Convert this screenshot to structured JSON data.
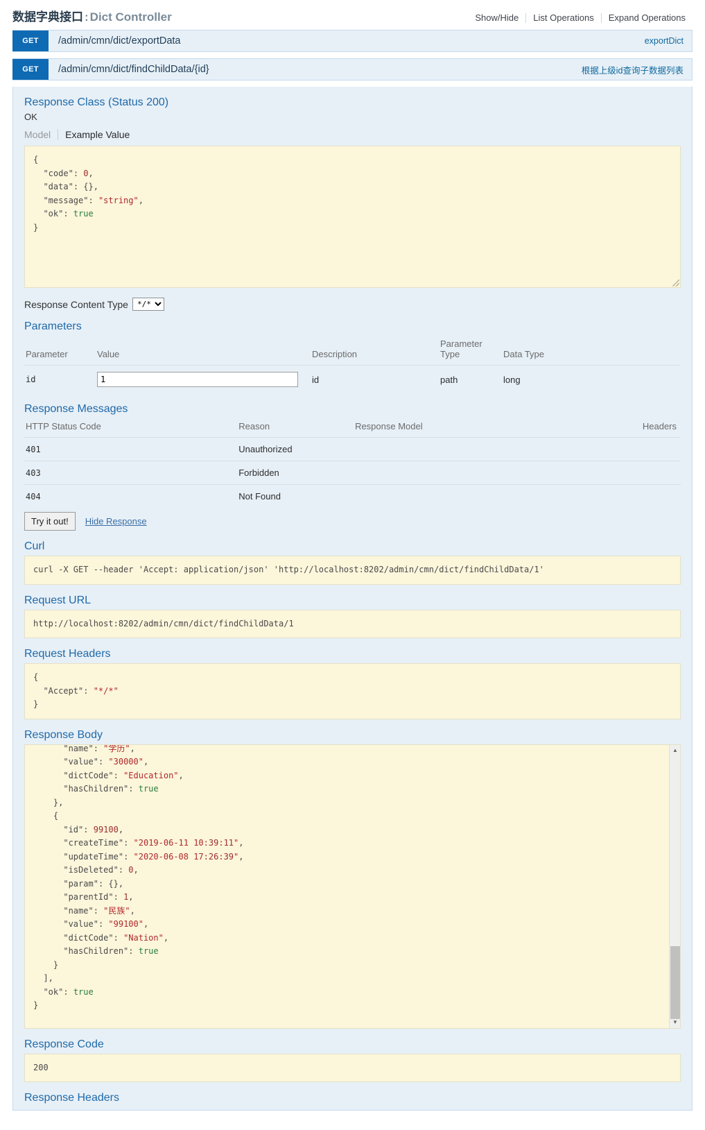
{
  "resource": {
    "title_cn": "数据字典接口",
    "title_sep": " : ",
    "title_en": "Dict Controller",
    "options": {
      "show_hide": "Show/Hide",
      "list_operations": "List Operations",
      "expand_operations": "Expand Operations"
    }
  },
  "endpoints": [
    {
      "method": "GET",
      "path": "/admin/cmn/dict/exportData",
      "summary": "exportDict"
    },
    {
      "method": "GET",
      "path": "/admin/cmn/dict/findChildData/{id}",
      "summary": "根据上级id查询子数据列表"
    }
  ],
  "operation": {
    "response_class_heading": "Response Class (Status 200)",
    "response_class_status": "OK",
    "model_tab": "Model",
    "example_value_tab": "Example Value",
    "example_value": "{\n  \"code\": 0,\n  \"data\": {},\n  \"message\": \"string\",\n  \"ok\": true\n}",
    "content_type_label": "Response Content Type",
    "content_type_selected": "*/*",
    "content_type_options": [
      "*/*"
    ],
    "parameters_heading": "Parameters",
    "parameters_columns": [
      "Parameter",
      "Value",
      "Description",
      "Parameter Type",
      "Data Type"
    ],
    "parameters_rows": [
      {
        "parameter": "id",
        "value": "1",
        "description": "id",
        "parameter_type": "path",
        "data_type": "long"
      }
    ],
    "response_messages_heading": "Response Messages",
    "response_messages_columns": [
      "HTTP Status Code",
      "Reason",
      "Response Model",
      "Headers"
    ],
    "response_messages_rows": [
      {
        "code": "401",
        "reason": "Unauthorized",
        "model": "",
        "headers": ""
      },
      {
        "code": "403",
        "reason": "Forbidden",
        "model": "",
        "headers": ""
      },
      {
        "code": "404",
        "reason": "Not Found",
        "model": "",
        "headers": ""
      }
    ],
    "try_it_out_label": "Try it out!",
    "hide_response_label": "Hide Response",
    "curl_heading": "Curl",
    "curl_command": "curl -X GET --header 'Accept: application/json' 'http://localhost:8202/admin/cmn/dict/findChildData/1'",
    "request_url_heading": "Request URL",
    "request_url": "http://localhost:8202/admin/cmn/dict/findChildData/1",
    "request_headers_heading": "Request Headers",
    "request_headers": "{\n  \"Accept\": \"*/*\"\n}",
    "response_body_heading": "Response Body",
    "response_body": "      \"name\": \"学历\",\n      \"value\": \"30000\",\n      \"dictCode\": \"Education\",\n      \"hasChildren\": true\n    },\n    {\n      \"id\": 99100,\n      \"createTime\": \"2019-06-11 10:39:11\",\n      \"updateTime\": \"2020-06-08 17:26:39\",\n      \"isDeleted\": 0,\n      \"param\": {},\n      \"parentId\": 1,\n      \"name\": \"民族\",\n      \"value\": \"99100\",\n      \"dictCode\": \"Nation\",\n      \"hasChildren\": true\n    }\n  ],\n  \"ok\": true\n}",
    "response_code_heading": "Response Code",
    "response_code": "200",
    "response_headers_heading": "Response Headers"
  },
  "colors": {
    "verb_get": "#0f6ab4",
    "heading_blue": "#1f69a8",
    "panel_bg": "#e7f0f7",
    "code_bg": "#fcf6db",
    "link_blue": "#10689e"
  }
}
